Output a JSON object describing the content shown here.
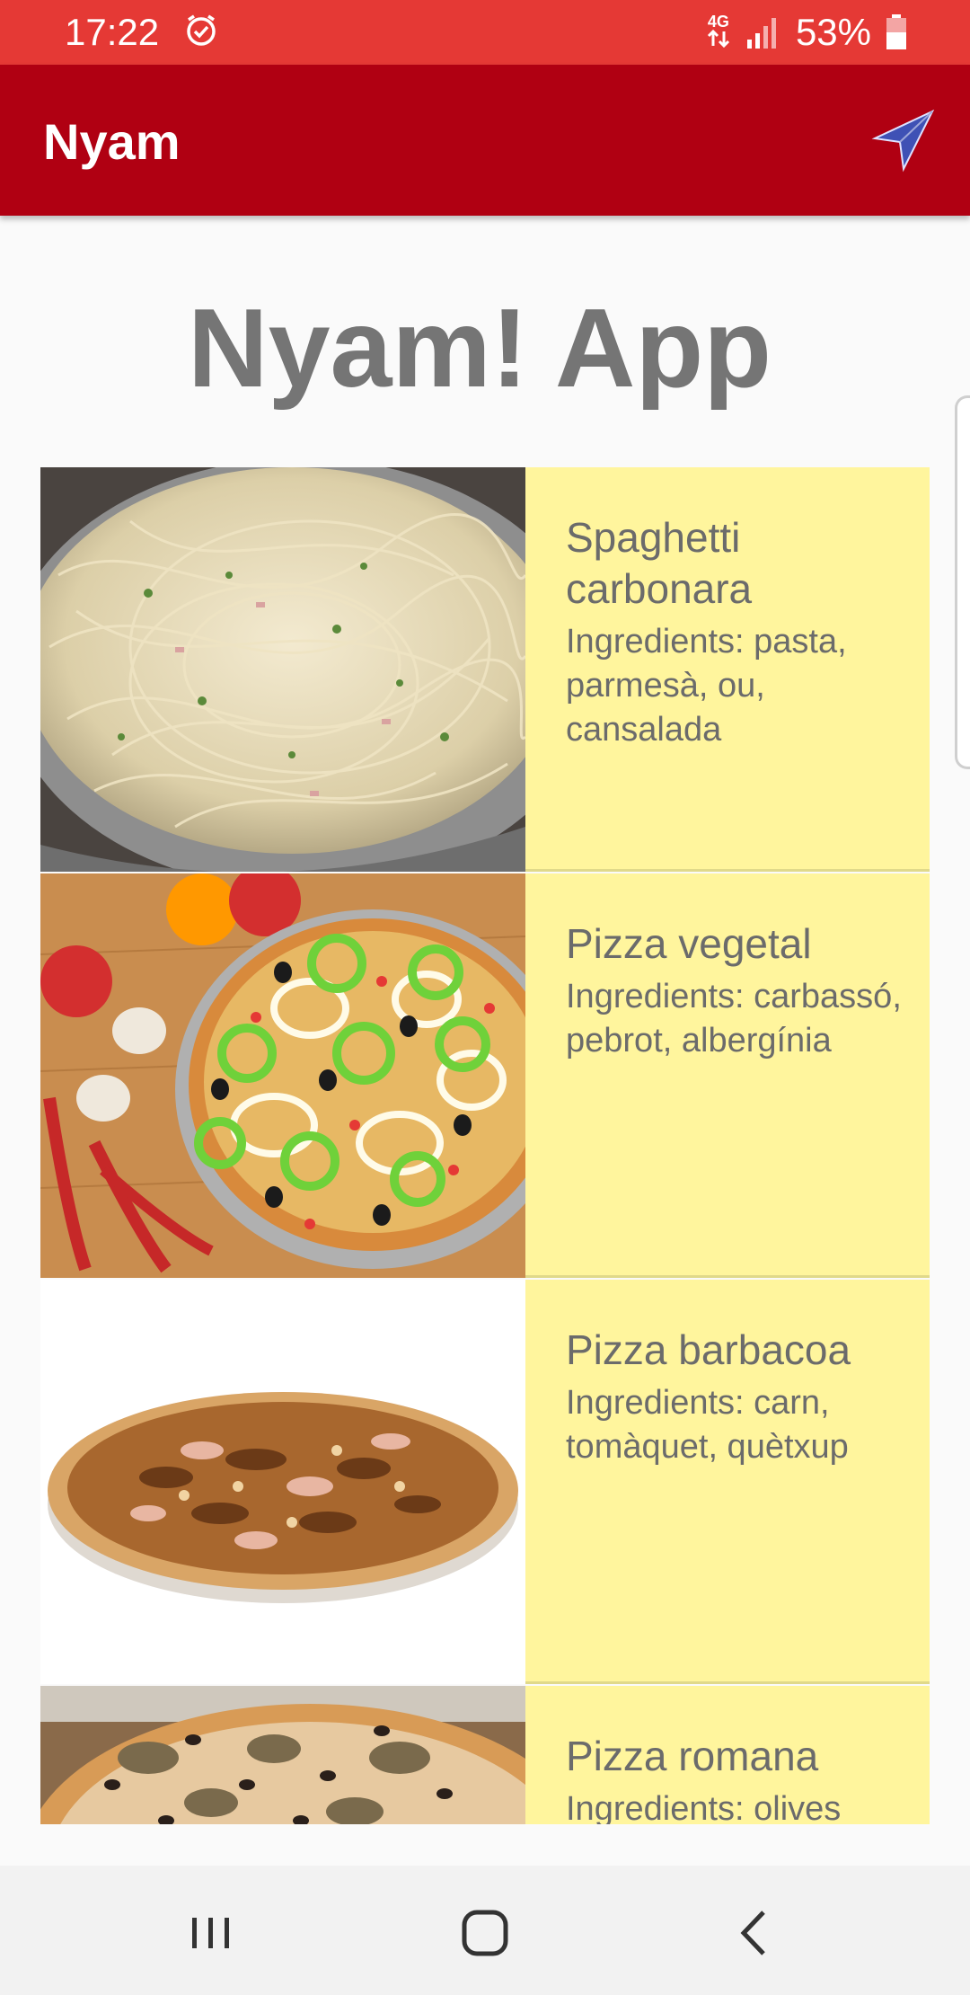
{
  "status_bar": {
    "time": "17:22",
    "network": "4G",
    "battery": "53%"
  },
  "app_bar": {
    "title": "Nyam"
  },
  "main": {
    "title": "Nyam! App",
    "recipes": [
      {
        "name": "Spaghetti carbonara",
        "ingredients": "Ingredients: pasta, parmesà, ou, cansalada",
        "image": "spaghetti-image"
      },
      {
        "name": "Pizza vegetal",
        "ingredients": "Ingredients: carbassó, pebrot, albergínia",
        "image": "vegetable-pizza-image"
      },
      {
        "name": "Pizza barbacoa",
        "ingredients": "Ingredients: carn, tomàquet, quètxup",
        "image": "bbq-pizza-image"
      },
      {
        "name": "Pizza romana",
        "ingredients": "Ingredients: olives",
        "image": "romana-pizza-image"
      }
    ]
  },
  "colors": {
    "status_bar": "#e53935",
    "app_bar": "#b00012",
    "card": "#fff59d",
    "nav_icon": "#3f51b5"
  }
}
